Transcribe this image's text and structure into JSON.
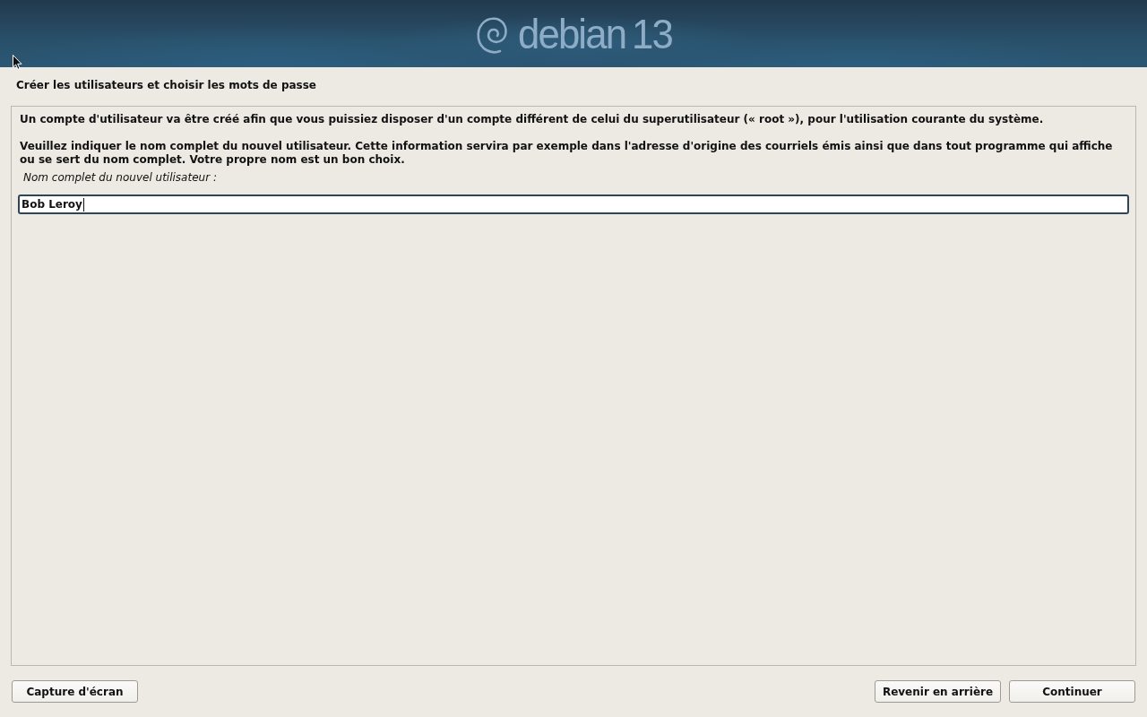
{
  "banner": {
    "wordmark": "debian",
    "version": "13"
  },
  "step_title": "Créer les utilisateurs et choisir les mots de passe",
  "paragraphs": [
    "Un compte d'utilisateur va être créé afin que vous puissiez disposer d'un compte différent de celui du superutilisateur (« root »), pour l'utilisation courante du système.",
    "Veuillez indiquer le nom complet du nouvel utilisateur. Cette information servira par exemple dans l'adresse d'origine des courriels émis ainsi que dans tout programme qui affiche ou se sert du nom complet. Votre propre nom est un bon choix."
  ],
  "field": {
    "label": "Nom complet du nouvel utilisateur :",
    "value": "Bob Leroy",
    "focused": true
  },
  "footer": {
    "left_buttons": [
      "Capture d'écran"
    ],
    "right_buttons": [
      "Revenir en arrière",
      "Continuer"
    ]
  }
}
